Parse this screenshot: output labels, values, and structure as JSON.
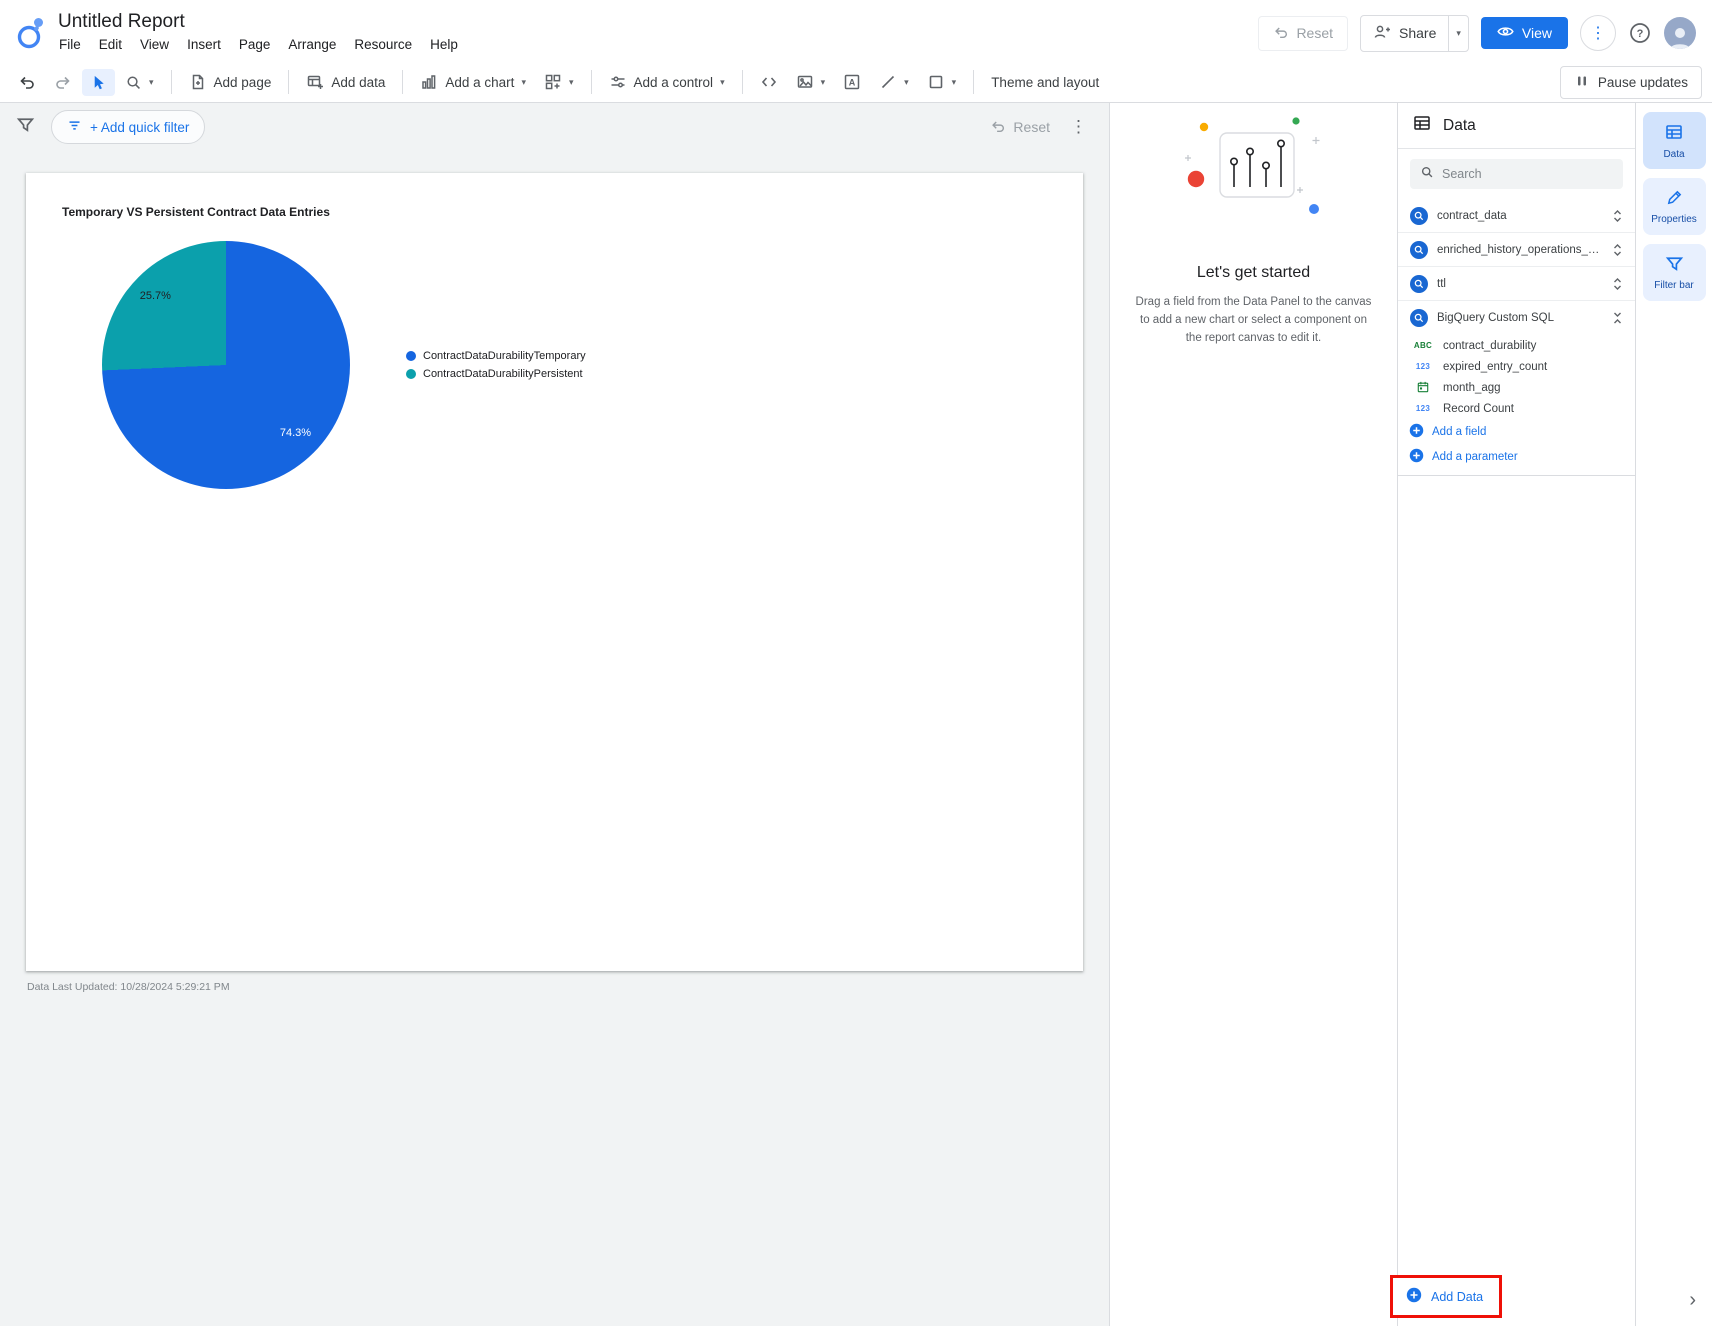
{
  "app": {
    "title": "Untitled Report",
    "menus": [
      "File",
      "Edit",
      "View",
      "Insert",
      "Page",
      "Arrange",
      "Resource",
      "Help"
    ]
  },
  "header": {
    "reset_label": "Reset",
    "share_label": "Share",
    "view_label": "View"
  },
  "toolbar": {
    "add_page": "Add page",
    "add_data": "Add data",
    "add_chart": "Add a chart",
    "add_control": "Add a control",
    "theme_layout": "Theme and layout",
    "pause_updates": "Pause updates"
  },
  "filter_bar": {
    "add_quick_filter": "+ Add quick filter",
    "reset_label": "Reset"
  },
  "canvas": {
    "last_updated": "Data Last Updated: 10/28/2024 5:29:21 PM"
  },
  "chart_data": {
    "type": "pie",
    "title": "Temporary VS Persistent Contract Data Entries",
    "slices": [
      {
        "label": "ContractDataDurabilityTemporary",
        "value": 74.3,
        "color": "#1565e0",
        "pct_text_color": "#ffffff"
      },
      {
        "label": "ContractDataDurabilityPersistent",
        "value": 25.7,
        "color": "#0ba0ac",
        "pct_text_color": "#202124"
      }
    ],
    "value_format": "percent",
    "legend_position": "right",
    "start_angle_deg": 0,
    "direction": "clockwise"
  },
  "getting_started": {
    "title": "Let's get started",
    "body": "Drag a field from the Data Panel to the canvas to add a new chart or select a component on the report canvas to edit it."
  },
  "data_panel": {
    "title": "Data",
    "search_placeholder": "Search",
    "sources": [
      {
        "name": "contract_data",
        "expanded": false
      },
      {
        "name": "enriched_history_operations_sorob...",
        "expanded": false
      },
      {
        "name": "ttl",
        "expanded": false
      },
      {
        "name": "BigQuery Custom SQL",
        "expanded": true
      }
    ],
    "fields": [
      {
        "type": "text",
        "type_glyph": "ABC",
        "name": "contract_durability"
      },
      {
        "type": "number",
        "type_glyph": "123",
        "name": "expired_entry_count"
      },
      {
        "type": "date",
        "type_glyph": "calendar",
        "name": "month_agg"
      },
      {
        "type": "number",
        "type_glyph": "123",
        "name": "Record Count"
      }
    ],
    "add_field": "Add a field",
    "add_parameter": "Add a parameter",
    "add_data": "Add Data"
  },
  "right_rail": {
    "tabs": [
      {
        "label": "Data",
        "active": true
      },
      {
        "label": "Properties",
        "active": false
      },
      {
        "label": "Filter bar",
        "active": false
      }
    ]
  },
  "colors": {
    "accent_blue": "#1a73e8",
    "pie_blue": "#1565e0",
    "pie_teal": "#0ba0ac",
    "annotation_red": "#ef1007",
    "canvas_gray": "#f1f3f4"
  },
  "icons": {
    "caret_down": "▾",
    "kebab": "⋮",
    "chevron_right": "›"
  }
}
